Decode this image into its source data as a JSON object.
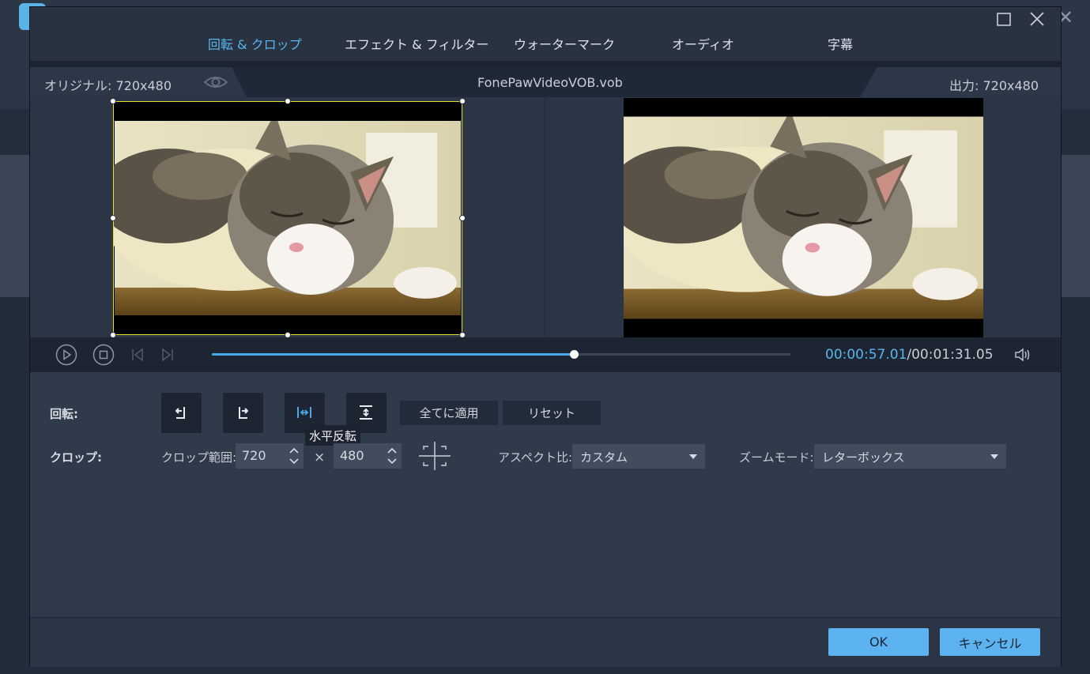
{
  "tabs": [
    {
      "label": "回転 & クロップ",
      "active": true
    },
    {
      "label": "エフェクト & フィルター"
    },
    {
      "label": "ウォーターマーク"
    },
    {
      "label": "オーディオ"
    },
    {
      "label": "字幕"
    }
  ],
  "info": {
    "original": "オリジナル: 720x480",
    "filename": "FonePawVideoVOB.vob",
    "output": "出力: 720x480"
  },
  "player": {
    "current_time": "00:00:57.01",
    "total_time": "/00:01:31.05",
    "progress": 0.625
  },
  "rotate": {
    "label": "回転:",
    "apply_all": "全てに適用",
    "reset": "リセット",
    "tooltip": "水平反転"
  },
  "crop": {
    "label": "クロップ:",
    "range_label": "クロップ範囲:",
    "width": "720",
    "times": "×",
    "height": "480",
    "aspect_label": "アスペクト比:",
    "aspect_value": "カスタム",
    "zoom_label": "ズームモード:",
    "zoom_value": "レターボックス"
  },
  "footer": {
    "ok": "OK",
    "cancel": "キャンセル"
  },
  "colors": {
    "accent": "#58b6ee",
    "button_primary": "#5db2f0",
    "crop_border": "#e6e02e"
  }
}
